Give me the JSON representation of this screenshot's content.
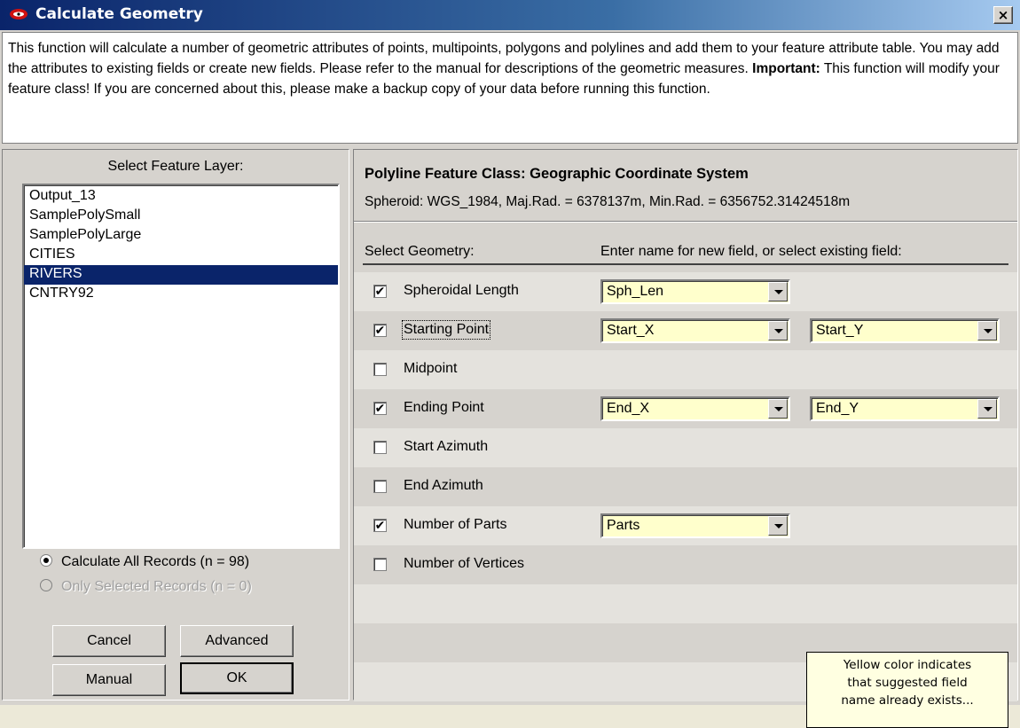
{
  "window": {
    "title": "Calculate Geometry",
    "close_label": "×"
  },
  "description": {
    "part1": "This function will calculate a number of geometric attributes of points, multipoints, polygons and polylines and add them to your feature attribute table.  You may add the attributes to existing fields or create new fields.  Please refer to the manual for descriptions of the geometric measures. ",
    "important": "Important:",
    "part2": "  This function will modify your feature class! If you are concerned about this, please make a backup copy of your data before running this function."
  },
  "left": {
    "layer_label": "Select Feature Layer:",
    "layers": [
      "Output_13",
      "SamplePolySmall",
      "SamplePolyLarge",
      "CITIES",
      "RIVERS",
      "CNTRY92"
    ],
    "selected_layer": "RIVERS",
    "radio_all": "Calculate All Records (n = 98)",
    "radio_selected": "Only Selected Records (n = 0)",
    "buttons": {
      "cancel": "Cancel",
      "advanced": "Advanced",
      "manual": "Manual",
      "ok": "OK"
    }
  },
  "right": {
    "feature_class_title": "Polyline Feature Class:  Geographic Coordinate System",
    "spheroid": "Spheroid: WGS_1984,  Maj.Rad. = 6378137m,  Min.Rad. = 6356752.31424518m",
    "col_geometry": "Select Geometry:",
    "col_field": "Enter name for new field, or select existing field:",
    "rows": [
      {
        "label": "Spheroidal Length",
        "checked": true,
        "field1": "Sph_Len"
      },
      {
        "label": "Starting Point",
        "checked": true,
        "field1": "Start_X",
        "field2": "Start_Y"
      },
      {
        "label": "Midpoint",
        "checked": false
      },
      {
        "label": "Ending Point",
        "checked": true,
        "field1": "End_X",
        "field2": "End_Y"
      },
      {
        "label": "Start Azimuth",
        "checked": false
      },
      {
        "label": "End Azimuth",
        "checked": false
      },
      {
        "label": "Number of Parts",
        "checked": true,
        "field1": "Parts"
      },
      {
        "label": "Number of Vertices",
        "checked": false
      }
    ],
    "note": [
      "Yellow color indicates",
      "that suggested field",
      "name already exists..."
    ]
  },
  "colors": {
    "title_bar": "#0a246a",
    "selection": "#0a246a",
    "existing_field": "#ffffcc",
    "note_bg": "#ffffe1"
  },
  "icons": {
    "app": "red-eye-icon",
    "close": "close-icon",
    "dropdown": "dropdown-arrow-icon",
    "check": "checkmark-icon"
  }
}
